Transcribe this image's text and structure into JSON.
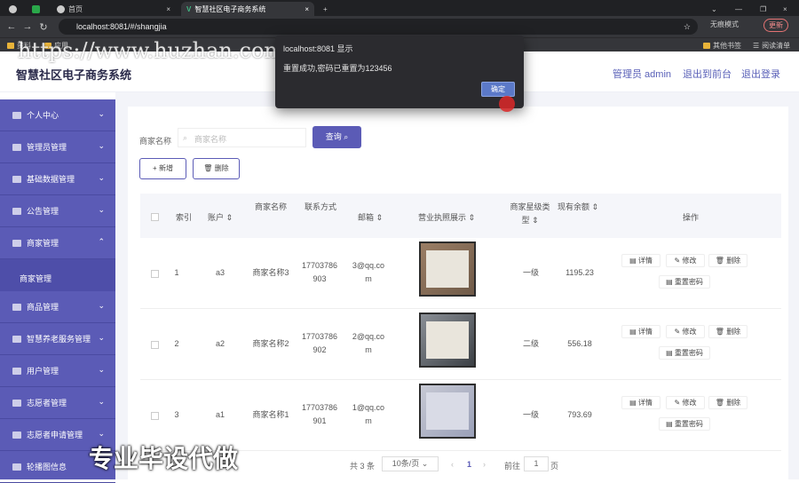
{
  "browser": {
    "tabs": [
      {
        "label": "首页"
      },
      {
        "label": "智慧社区电子商务系统"
      }
    ],
    "new_tab": "+",
    "url": "localhost:8081/#/shangjia",
    "incognito_label": "无痕模式",
    "update_label": "更新",
    "bookmarks": [
      {
        "label": "资料"
      },
      {
        "label": "应用"
      }
    ],
    "bookmarks_right": [
      {
        "label": "其他书签"
      },
      {
        "label": "阅读清单"
      }
    ]
  },
  "header": {
    "title": "智慧社区电子商务系统",
    "admin": "管理员 admin",
    "back_front": "退出到前台",
    "logout": "退出登录"
  },
  "sidebar": {
    "items": [
      {
        "label": "个人中心"
      },
      {
        "label": "管理员管理"
      },
      {
        "label": "基础数据管理"
      },
      {
        "label": "公告管理"
      },
      {
        "label": "商家管理"
      },
      {
        "label": "商品管理"
      },
      {
        "label": "智慧养老服务管理"
      },
      {
        "label": "用户管理"
      },
      {
        "label": "志愿者管理"
      },
      {
        "label": "志愿者申请管理"
      },
      {
        "label": "轮播图信息"
      }
    ],
    "subitem": "商家管理"
  },
  "search": {
    "label": "商家名称",
    "placeholder": "商家名称",
    "button": "查询"
  },
  "actions": {
    "add": "+ 新增",
    "delete": "删除"
  },
  "table": {
    "headers": {
      "index": "索引",
      "account": "账户",
      "name": "商家名称",
      "contact": "联系方式",
      "email": "邮箱",
      "license": "营业执照展示",
      "level": "商家星级类型",
      "balance": "现有余额",
      "ops": "操作"
    },
    "rows": [
      {
        "index": "1",
        "account": "a3",
        "name": "商家名称3",
        "contact": "17703786903",
        "email": "3@qq.com",
        "level": "一级",
        "balance": "1195.23"
      },
      {
        "index": "2",
        "account": "a2",
        "name": "商家名称2",
        "contact": "17703786902",
        "email": "2@qq.com",
        "level": "二级",
        "balance": "556.18"
      },
      {
        "index": "3",
        "account": "a1",
        "name": "商家名称1",
        "contact": "17703786901",
        "email": "1@qq.com",
        "level": "一级",
        "balance": "793.69"
      }
    ],
    "op_labels": {
      "detail": "详情",
      "edit": "修改",
      "delete": "删除",
      "reset": "重置密码"
    }
  },
  "pagination": {
    "total": "共 3 条",
    "page_size": "10条/页",
    "current": "1",
    "goto_label": "前往",
    "goto_value": "1",
    "page_unit": "页"
  },
  "dialog": {
    "title": "localhost:8081 显示",
    "message": "重置成功,密码已重置为123456",
    "ok": "确定"
  },
  "watermarks": {
    "url": "https://www.huzhan.com/ishop39397",
    "bottom": "专业毕设代做"
  },
  "colors": {
    "sidebar": "#5b5bb6",
    "accent": "#5b5bb6"
  }
}
